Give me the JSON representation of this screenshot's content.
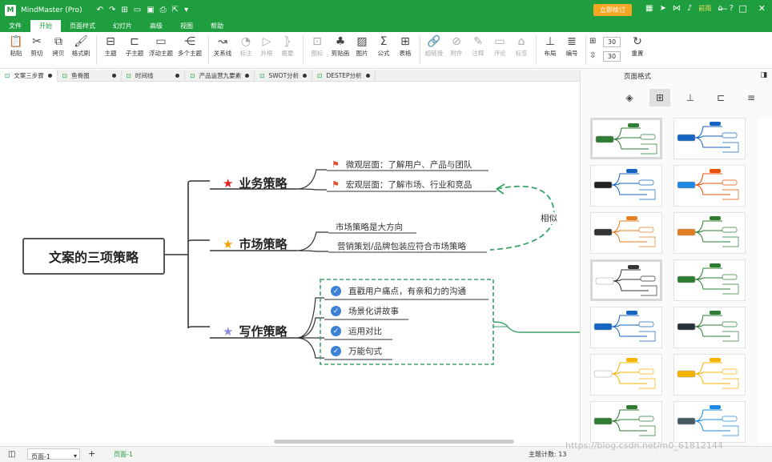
{
  "app": {
    "title": "MindMaster (Pro)",
    "logo": "M",
    "upgrade_label": "立即续订",
    "user_label": "前雨"
  },
  "menubar": [
    "文件",
    "开始",
    "页面样式",
    "幻灯片",
    "高级",
    "视图",
    "帮助"
  ],
  "ribbon": {
    "buttons": [
      "粘贴",
      "剪切",
      "拷贝",
      "格式刷",
      "主题",
      "子主题",
      "浮动主题",
      "多个主题",
      "关系线",
      "标注",
      "外框",
      "概要",
      "图标",
      "剪贴画",
      "图片",
      "公式",
      "表格",
      "超链接",
      "附件",
      "注释",
      "评论",
      "标签",
      "布局",
      "编号",
      "重置"
    ],
    "spin1": "30",
    "spin2": "30"
  },
  "tabs": [
    "文案三步骤",
    "鱼骨图",
    "时间线",
    "产品运营九要素",
    "SWOT分析",
    "DESTEP分析"
  ],
  "mindmap": {
    "root": "文案的三项策略",
    "branches": [
      {
        "label": "业务策略",
        "children": [
          "微观层面：了解用户、产品与团队",
          "宏观层面：了解市场、行业和竞品"
        ]
      },
      {
        "label": "市场策略",
        "children": [
          "市场策略是大方向",
          "营销策划/品牌包装应符合市场策略"
        ]
      },
      {
        "label": "写作策略",
        "children": [
          "直戳用户痛点，有亲和力的沟通",
          "场景化讲故事",
          "运用对比",
          "万能句式"
        ]
      }
    ],
    "relation_label": "相似"
  },
  "panel": {
    "title": "页面格式"
  },
  "status": {
    "page_select": "页面-1",
    "page_tab": "页面-1",
    "count": "主题计数: 13"
  },
  "watermark": "https://blog.csdn.net/m0_61812144",
  "colors": {
    "brand": "#1e9e3e",
    "star_red": "#e02020",
    "star_orange": "#f5a000",
    "star_purple": "#8e8cd8",
    "check_blue": "#3b82d6",
    "dash_green": "#3aa36a"
  }
}
